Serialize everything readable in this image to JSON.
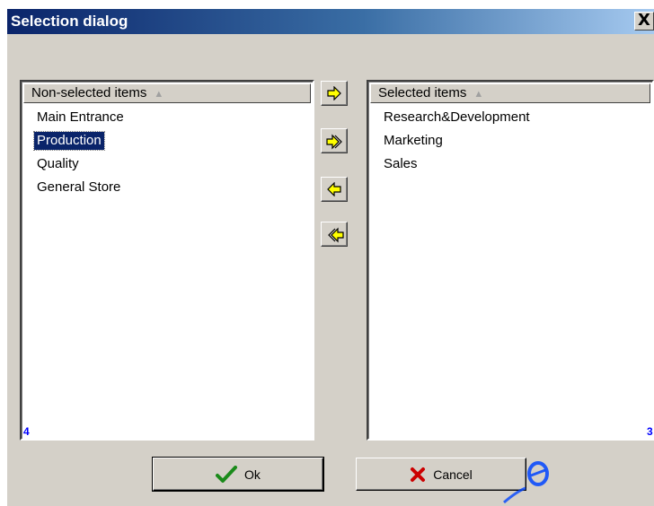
{
  "window": {
    "title": "Selection dialog",
    "close_label": "X"
  },
  "left_list": {
    "header": "Non-selected items",
    "sort_glyph": "▲",
    "items": [
      {
        "label": "Main Entrance",
        "selected": false
      },
      {
        "label": "Production",
        "selected": true
      },
      {
        "label": "Quality",
        "selected": false
      },
      {
        "label": "General Store",
        "selected": false
      }
    ],
    "count": "4"
  },
  "right_list": {
    "header": "Selected items",
    "sort_glyph": "▲",
    "items": [
      {
        "label": "Research&Development"
      },
      {
        "label": "Marketing"
      },
      {
        "label": "Sales"
      }
    ],
    "count": "3"
  },
  "transfer_buttons": [
    {
      "icon": "move-right-icon"
    },
    {
      "icon": "move-all-right-icon"
    },
    {
      "icon": "move-left-icon"
    },
    {
      "icon": "move-all-left-icon"
    }
  ],
  "buttons": {
    "ok_label": "Ok",
    "cancel_label": "Cancel"
  },
  "colors": {
    "title_start": "#0a246a",
    "title_end": "#a6caf0",
    "selection": "#0a246a",
    "arrow_yellow": "#ffff00",
    "count_blue": "#0000ff",
    "ok_green": "#1a8a1a",
    "cancel_red": "#cc0000"
  }
}
